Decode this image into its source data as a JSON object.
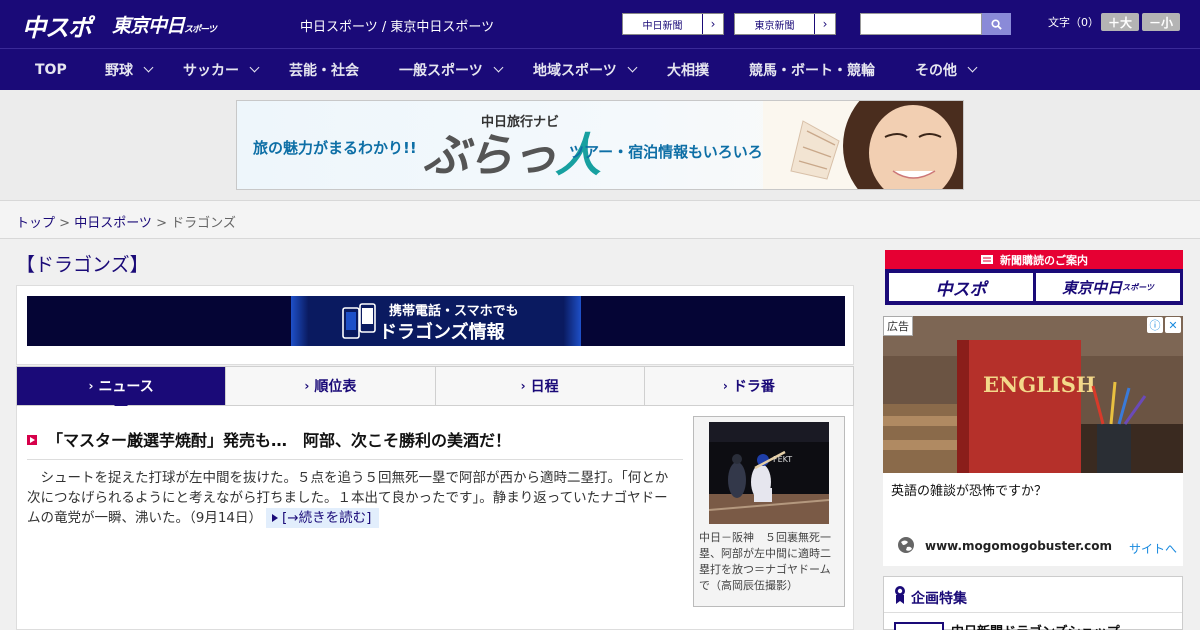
{
  "header": {
    "logo_chuspo": "中スポ",
    "logo_tokyo": "東京中日",
    "logo_tokyo_sub": "スポーツ",
    "site_links": "中日スポーツ / 東京中日スポーツ",
    "ext_links": [
      {
        "label": "中日新聞"
      },
      {
        "label": "東京新聞"
      }
    ],
    "search": {
      "value": "",
      "placeholder": ""
    },
    "font_size_label": "文字（0）",
    "font_larger": "＋大",
    "font_smaller": "－小"
  },
  "nav": {
    "items": [
      {
        "label": "TOP"
      },
      {
        "label": "野球"
      },
      {
        "label": "サッカー"
      },
      {
        "label": "芸能・社会"
      },
      {
        "label": "一般スポーツ"
      },
      {
        "label": "地域スポーツ"
      },
      {
        "label": "大相撲"
      },
      {
        "label": "競馬・ボート・競輪"
      },
      {
        "label": "その他"
      }
    ]
  },
  "ad_banner": {
    "left_text": "旅の魅力がまるわかり!!",
    "brand_sub": "中日旅行ナビ",
    "brand_a": "ぶらっ",
    "brand_b": "人",
    "right_text": "ツアー・宿泊情報もいろいろ"
  },
  "breadcrumb": {
    "top": "トップ",
    "sep1": " > ",
    "section": "中日スポーツ",
    "sep2": " > ",
    "current": "ドラゴンズ"
  },
  "page_title": "【ドラゴンズ】",
  "promo": {
    "line1": "携帯電話・スマホでも",
    "line2": "ドラゴンズ情報"
  },
  "tabs": [
    {
      "label": "ニュース",
      "active": true
    },
    {
      "label": "順位表",
      "active": false
    },
    {
      "label": "日程",
      "active": false
    },
    {
      "label": "ドラ番",
      "active": false
    }
  ],
  "article": {
    "title": "「マスター厳選芋焼酎」発売も…　阿部、次こそ勝利の美酒だ！",
    "body": "　シュートを捉えた打球が左中間を抜けた。５点を追う５回無死一塁で阿部が西から適時二塁打。「何とか次につなげられるようにと考えながら打ちました。１本出て良かったです」。静まり返っていたナゴヤドームの竜党が一瞬、沸いた。（9月14日）",
    "read_more": "[→続きを読む]",
    "photo_caption": "中日－阪神　５回裏無死一塁、阿部が左中間に適時二塁打を放つ＝ナゴヤドームで（高岡辰伍撮影）"
  },
  "sidebar": {
    "subscribe_title": "新聞購読のご案内",
    "subscribe_chuspo": "中スポ",
    "subscribe_tokyo": "東京中日",
    "subscribe_tokyo_sub": "スポーツ",
    "ad": {
      "tag": "広告",
      "book_title": "ENGLISH",
      "question": "英語の雑談が恐怖ですか？",
      "url": "www.mogomogobuster.com",
      "site_link": "サイトへ"
    },
    "feature": {
      "title": "企画特集",
      "item": "中日新聞ドラゴンズショップ"
    }
  },
  "colors": {
    "brand_navy": "#1a0a78",
    "accent_red": "#e60033",
    "link_blue": "#1a8adf"
  }
}
